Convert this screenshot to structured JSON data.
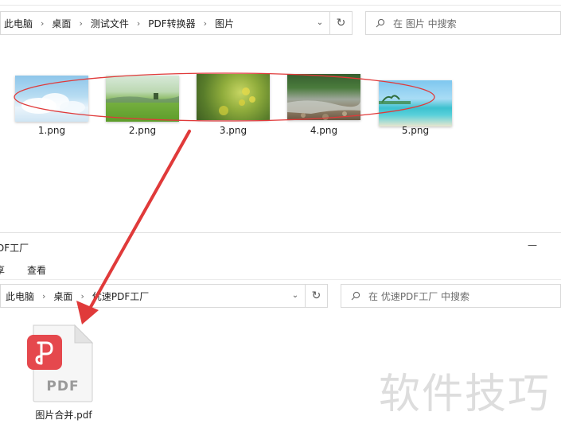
{
  "top_window": {
    "breadcrumbs": [
      "此电脑",
      "桌面",
      "测试文件",
      "PDF转换器",
      "图片"
    ],
    "search_placeholder": "在 图片 中搜索",
    "files": [
      {
        "name": "1.png"
      },
      {
        "name": "2.png"
      },
      {
        "name": "3.png"
      },
      {
        "name": "4.png"
      },
      {
        "name": "5.png"
      }
    ]
  },
  "bottom_window": {
    "title": "DF工厂",
    "ribbon_tab_cut": "享",
    "ribbon_tab_view": "查看",
    "breadcrumbs": [
      "此电脑",
      "桌面",
      "优速PDF工厂"
    ],
    "search_placeholder": "在 优速PDF工厂 中搜索",
    "file": {
      "name": "图片合并.pdf",
      "badge": "PDF"
    }
  },
  "watermark": "软件技巧",
  "colors": {
    "annotation_red": "#e03a3a",
    "pdf_accent": "#e5484d"
  }
}
